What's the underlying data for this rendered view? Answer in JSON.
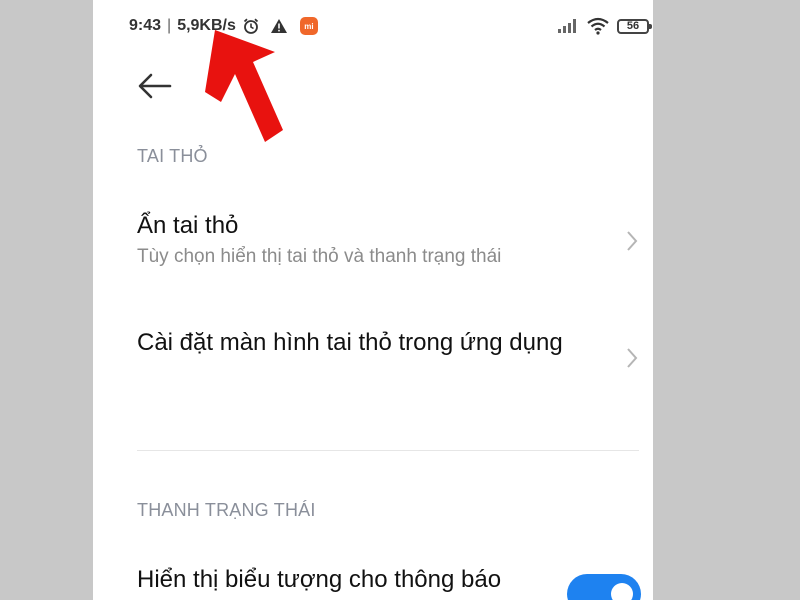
{
  "status_bar": {
    "time": "9:43",
    "separator": "|",
    "net_speed": "5,9KB/s",
    "battery": "56",
    "icons": [
      "alarm-clock-icon",
      "warning-icon",
      "mi-app-icon",
      "signal-icon",
      "wifi-icon",
      "battery-icon"
    ],
    "mi_label": "mi"
  },
  "nav": {
    "back_icon": "arrow-left-icon"
  },
  "sections": {
    "notch": {
      "label": "TAI THỎ",
      "hide_notch": {
        "title": "Ẩn tai thỏ",
        "subtitle": "Tùy chọn hiển thị tai thỏ và thanh trạng thái"
      },
      "app_notch_settings": {
        "title": "Cài đặt màn hình tai thỏ trong ứng dụng"
      }
    },
    "status_bar_settings": {
      "label": "THANH TRẠNG THÁI",
      "show_notification_icons": {
        "title": "Hiển thị biểu tượng cho thông báo",
        "enabled": true
      }
    }
  },
  "colors": {
    "accent": "#1e82f0",
    "annotation_arrow": "#e8120f",
    "section_label": "#8a8f9a",
    "mi_badge": "#f0672a"
  }
}
